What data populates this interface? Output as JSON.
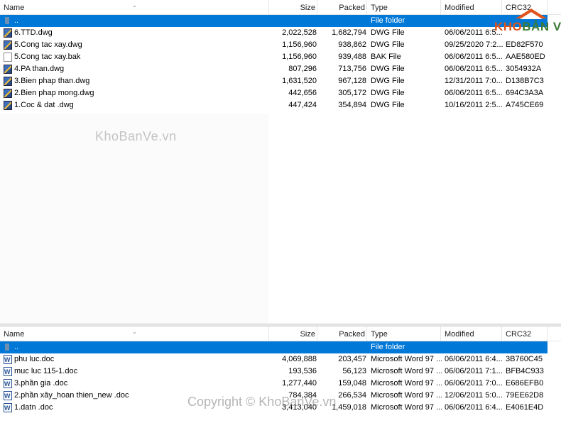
{
  "columns": {
    "name": "Name",
    "size": "Size",
    "packed": "Packed",
    "type": "Type",
    "modified": "Modified",
    "crc": "CRC32"
  },
  "top_pane": {
    "up_row": {
      "name": "..",
      "type": "File folder"
    },
    "files": [
      {
        "icon": "dwg-file-icon",
        "name": "6.TTD.dwg",
        "size": "2,022,528",
        "packed": "1,682,794",
        "type": "DWG File",
        "modified": "06/06/2011 6:5...",
        "crc": ""
      },
      {
        "icon": "dwg-file-icon",
        "name": "5.Cong tac xay.dwg",
        "size": "1,156,960",
        "packed": "938,862",
        "type": "DWG File",
        "modified": "09/25/2020 7:2...",
        "crc": "ED82F570"
      },
      {
        "icon": "bak-file-icon",
        "name": "5.Cong tac xay.bak",
        "size": "1,156,960",
        "packed": "939,488",
        "type": "BAK File",
        "modified": "06/06/2011 6:5...",
        "crc": "AAE580ED"
      },
      {
        "icon": "dwg-file-icon",
        "name": "4.PA than.dwg",
        "size": "807,296",
        "packed": "713,756",
        "type": "DWG File",
        "modified": "06/06/2011 6:5...",
        "crc": "3054932A"
      },
      {
        "icon": "dwg-file-icon",
        "name": "3.Bien phap than.dwg",
        "size": "1,631,520",
        "packed": "967,128",
        "type": "DWG File",
        "modified": "12/31/2011 7:0...",
        "crc": "D138B7C3"
      },
      {
        "icon": "dwg-file-icon",
        "name": "2.Bien phap mong.dwg",
        "size": "442,656",
        "packed": "305,172",
        "type": "DWG File",
        "modified": "06/06/2011 6:5...",
        "crc": "694C3A3A"
      },
      {
        "icon": "dwg-file-icon",
        "name": "1.Coc & dat .dwg",
        "size": "447,424",
        "packed": "354,894",
        "type": "DWG File",
        "modified": "10/16/2011 2:5...",
        "crc": "A745CE69"
      }
    ]
  },
  "bottom_pane": {
    "up_row": {
      "name": "..",
      "type": "File folder"
    },
    "files": [
      {
        "icon": "word-doc-icon",
        "name": "phu luc.doc",
        "size": "4,069,888",
        "packed": "203,457",
        "type": "Microsoft Word 97 ...",
        "modified": "06/06/2011 6:4...",
        "crc": "3B760C45"
      },
      {
        "icon": "word-doc-icon",
        "name": "muc luc 115-1.doc",
        "size": "193,536",
        "packed": "56,123",
        "type": "Microsoft Word 97 ...",
        "modified": "06/06/2011 7:1...",
        "crc": "BFB4C933"
      },
      {
        "icon": "word-doc-icon",
        "name": "3.phần gia .doc",
        "size": "1,277,440",
        "packed": "159,048",
        "type": "Microsoft Word 97 ...",
        "modified": "06/06/2011 7:0...",
        "crc": "E686EFB0"
      },
      {
        "icon": "word-doc-icon",
        "name": "2.phần xây_hoan thien_new .doc",
        "size": "784,384",
        "packed": "266,534",
        "type": "Microsoft Word 97 ...",
        "modified": "12/06/2011 5:0...",
        "crc": "79EE62D8"
      },
      {
        "icon": "word-doc-icon",
        "name": "1.datn .doc",
        "size": "3,413,040",
        "packed": "1,459,018",
        "type": "Microsoft Word 97 ...",
        "modified": "06/06/2011 6:4...",
        "crc": "E4061E4D"
      }
    ]
  },
  "watermarks": {
    "logo_part1": "KHO",
    "logo_part2": "BẢN VẼ",
    "center": "KhoBanVe.vn",
    "copyright": "Copyright © KhoBanVe.vn"
  },
  "colors": {
    "selection": "#0078d7",
    "logo_orange": "#e0541c",
    "logo_green": "#3d7a35"
  }
}
